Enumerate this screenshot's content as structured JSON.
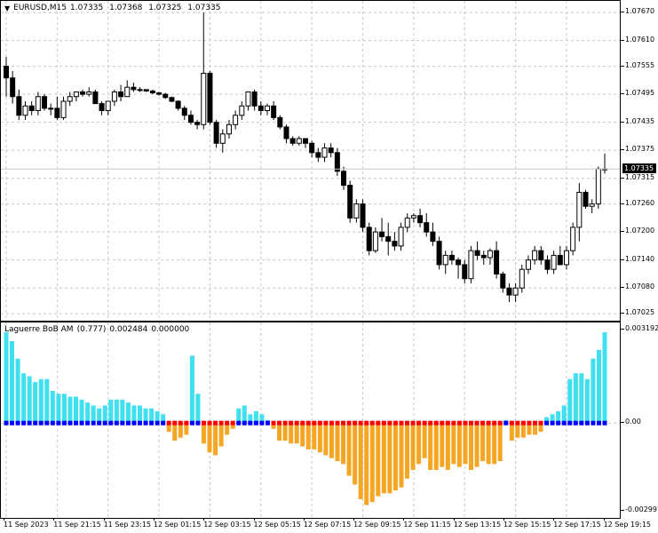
{
  "symbol_header": {
    "arrow": "▼",
    "symbol": "EURUSD,M15",
    "open": "1.07335",
    "high": "1.07368",
    "low": "1.07325",
    "close": "1.07335"
  },
  "indicator_header": {
    "name": "Laguerre BoB AM",
    "param": "(0.777)",
    "value1": "0.002484",
    "value2": "0.000000"
  },
  "price_axis": {
    "labels": [
      "1.07670",
      "1.07610",
      "1.07555",
      "1.07495",
      "1.07435",
      "1.07375",
      "1.07315",
      "1.07260",
      "1.07200",
      "1.07140",
      "1.07080",
      "1.07025"
    ],
    "values": [
      1.0767,
      1.0761,
      1.07555,
      1.07495,
      1.07435,
      1.07375,
      1.07315,
      1.0726,
      1.072,
      1.0714,
      1.0708,
      1.07025
    ],
    "min": 1.0701,
    "max": 1.07695,
    "current_price": "1.07335",
    "current_value": 1.07335
  },
  "indicator_axis": {
    "labels": [
      "0.003192",
      "0.00",
      "-0.002997"
    ],
    "values": [
      0.003192,
      0.0,
      -0.002997
    ]
  },
  "time_axis": {
    "labels": [
      "11 Sep 2023",
      "11 Sep 21:15",
      "11 Sep 23:15",
      "12 Sep 01:15",
      "12 Sep 03:15",
      "12 Sep 05:15",
      "12 Sep 07:15",
      "12 Sep 09:15",
      "12 Sep 11:15",
      "12 Sep 13:15",
      "12 Sep 15:15",
      "12 Sep 17:15",
      "12 Sep 19:15"
    ]
  },
  "chart_data": [
    {
      "type": "candlestick",
      "title": "EURUSD,M15",
      "ylim": [
        1.0701,
        1.07695
      ],
      "grid": true,
      "candles": [
        [
          1.07555,
          1.07575,
          1.0749,
          1.0753
        ],
        [
          1.0753,
          1.07545,
          1.07475,
          1.0749
        ],
        [
          1.0749,
          1.07505,
          1.0744,
          1.0745
        ],
        [
          1.0745,
          1.0748,
          1.0744,
          1.0747
        ],
        [
          1.0747,
          1.0748,
          1.0745,
          1.0746
        ],
        [
          1.0746,
          1.075,
          1.0745,
          1.0749
        ],
        [
          1.0749,
          1.07495,
          1.0746,
          1.07465
        ],
        [
          1.07465,
          1.07475,
          1.0745,
          1.07465
        ],
        [
          1.07465,
          1.0749,
          1.0744,
          1.07445
        ],
        [
          1.07445,
          1.0749,
          1.0744,
          1.0748
        ],
        [
          1.0748,
          1.075,
          1.0747,
          1.0749
        ],
        [
          1.0749,
          1.075,
          1.0748,
          1.075
        ],
        [
          1.075,
          1.07505,
          1.0749,
          1.07495
        ],
        [
          1.07495,
          1.0751,
          1.0749,
          1.075
        ],
        [
          1.075,
          1.07505,
          1.0748,
          1.07475
        ],
        [
          1.07475,
          1.0748,
          1.0745,
          1.0746
        ],
        [
          1.0746,
          1.0748,
          1.0745,
          1.0748
        ],
        [
          1.0748,
          1.07505,
          1.0747,
          1.075
        ],
        [
          1.075,
          1.07515,
          1.0748,
          1.0749
        ],
        [
          1.0749,
          1.07525,
          1.0749,
          1.0751
        ],
        [
          1.0751,
          1.0752,
          1.075,
          1.07505
        ],
        [
          1.07505,
          1.0751,
          1.075,
          1.07505
        ],
        [
          1.07505,
          1.07505,
          1.075,
          1.07502
        ],
        [
          1.07502,
          1.07505,
          1.07495,
          1.07498
        ],
        [
          1.07498,
          1.075,
          1.07492,
          1.07495
        ],
        [
          1.07495,
          1.07498,
          1.07485,
          1.07488
        ],
        [
          1.07488,
          1.0749,
          1.07478,
          1.0748
        ],
        [
          1.0748,
          1.07482,
          1.0746,
          1.07465
        ],
        [
          1.07465,
          1.0747,
          1.0744,
          1.0745
        ],
        [
          1.0745,
          1.0746,
          1.0743,
          1.07435
        ],
        [
          1.07435,
          1.0744,
          1.0742,
          1.0743
        ],
        [
          1.0743,
          1.0767,
          1.0742,
          1.0754
        ],
        [
          1.0754,
          1.07545,
          1.0743,
          1.07435
        ],
        [
          1.07435,
          1.0744,
          1.0738,
          1.0739
        ],
        [
          1.0739,
          1.0742,
          1.0737,
          1.0741
        ],
        [
          1.0741,
          1.0744,
          1.074,
          1.0743
        ],
        [
          1.0743,
          1.0746,
          1.0742,
          1.0745
        ],
        [
          1.0745,
          1.0748,
          1.0744,
          1.0747
        ],
        [
          1.0747,
          1.075,
          1.0746,
          1.075
        ],
        [
          1.075,
          1.07505,
          1.0746,
          1.0747
        ],
        [
          1.0747,
          1.0748,
          1.0745,
          1.0746
        ],
        [
          1.0746,
          1.07475,
          1.0745,
          1.0747
        ],
        [
          1.0747,
          1.0748,
          1.0744,
          1.07445
        ],
        [
          1.07445,
          1.0745,
          1.0742,
          1.07425
        ],
        [
          1.07425,
          1.0743,
          1.0739,
          1.074
        ],
        [
          1.074,
          1.07405,
          1.07385,
          1.0739
        ],
        [
          1.0739,
          1.07405,
          1.07385,
          1.074
        ],
        [
          1.074,
          1.074,
          1.0738,
          1.0739
        ],
        [
          1.0739,
          1.07395,
          1.0736,
          1.0737
        ],
        [
          1.0737,
          1.0738,
          1.0735,
          1.0736
        ],
        [
          1.0736,
          1.0739,
          1.0735,
          1.0738
        ],
        [
          1.0738,
          1.0739,
          1.0736,
          1.0737
        ],
        [
          1.0737,
          1.0738,
          1.0732,
          1.0733
        ],
        [
          1.0733,
          1.0734,
          1.0729,
          1.073
        ],
        [
          1.073,
          1.0731,
          1.0722,
          1.0723
        ],
        [
          1.0723,
          1.0727,
          1.0722,
          1.0726
        ],
        [
          1.0726,
          1.0727,
          1.072,
          1.0721
        ],
        [
          1.0721,
          1.0722,
          1.0715,
          1.0716
        ],
        [
          1.0716,
          1.0721,
          1.07155,
          1.072
        ],
        [
          1.072,
          1.0723,
          1.0718,
          1.0719
        ],
        [
          1.0719,
          1.0722,
          1.0715,
          1.0718
        ],
        [
          1.0718,
          1.072,
          1.0716,
          1.0717
        ],
        [
          1.0717,
          1.0722,
          1.0716,
          1.0721
        ],
        [
          1.0721,
          1.0724,
          1.072,
          1.0723
        ],
        [
          1.0723,
          1.0724,
          1.0722,
          1.07235
        ],
        [
          1.07235,
          1.0725,
          1.0721,
          1.0722
        ],
        [
          1.0722,
          1.0724,
          1.0719,
          1.072
        ],
        [
          1.072,
          1.0722,
          1.0717,
          1.0718
        ],
        [
          1.0718,
          1.0719,
          1.0712,
          1.0713
        ],
        [
          1.0713,
          1.0716,
          1.0711,
          1.0715
        ],
        [
          1.0715,
          1.0716,
          1.0713,
          1.0714
        ],
        [
          1.0714,
          1.07145,
          1.071,
          1.0713
        ],
        [
          1.0713,
          1.0714,
          1.0709,
          1.071
        ],
        [
          1.071,
          1.0717,
          1.0709,
          1.0716
        ],
        [
          1.0716,
          1.0718,
          1.0714,
          1.0715
        ],
        [
          1.0715,
          1.0716,
          1.0713,
          1.07145
        ],
        [
          1.07145,
          1.07165,
          1.0713,
          1.0716
        ],
        [
          1.0716,
          1.0718,
          1.071,
          1.0711
        ],
        [
          1.0711,
          1.07115,
          1.0707,
          1.0708
        ],
        [
          1.0708,
          1.0709,
          1.0705,
          1.07065
        ],
        [
          1.07065,
          1.0709,
          1.0705,
          1.0708
        ],
        [
          1.0708,
          1.0713,
          1.0707,
          1.0712
        ],
        [
          1.0712,
          1.0715,
          1.0711,
          1.0714
        ],
        [
          1.0714,
          1.0717,
          1.0713,
          1.0716
        ],
        [
          1.0716,
          1.0717,
          1.0713,
          1.0714
        ],
        [
          1.0714,
          1.0715,
          1.0711,
          1.0712
        ],
        [
          1.0712,
          1.0716,
          1.0711,
          1.0715
        ],
        [
          1.0715,
          1.0717,
          1.0713,
          1.0713
        ],
        [
          1.0713,
          1.0717,
          1.0712,
          1.0716
        ],
        [
          1.0716,
          1.0722,
          1.0715,
          1.0721
        ],
        [
          1.0721,
          1.07305,
          1.0718,
          1.07285
        ],
        [
          1.07285,
          1.0729,
          1.0725,
          1.07255
        ],
        [
          1.07255,
          1.0727,
          1.0724,
          1.0726
        ],
        [
          1.0726,
          1.0734,
          1.0725,
          1.07335
        ],
        [
          1.07335,
          1.07368,
          1.07325,
          1.07335
        ]
      ]
    },
    {
      "type": "bar",
      "title": "Laguerre BoB AM (0.777)",
      "ylim": [
        -0.002997,
        0.003192
      ],
      "zero_colors": {
        "positive": "#0000ff",
        "negative": "#ff0000"
      },
      "bar_colors": {
        "positive": "#40e0f0",
        "negative": "#f5a623"
      },
      "values": [
        0.0031,
        0.0028,
        0.0022,
        0.0017,
        0.0016,
        0.0014,
        0.0015,
        0.0015,
        0.0011,
        0.001,
        0.001,
        0.0009,
        0.0009,
        0.0008,
        0.0007,
        0.0006,
        0.0005,
        0.0006,
        0.0008,
        0.0008,
        0.0008,
        0.0007,
        0.0006,
        0.0006,
        0.0005,
        0.0005,
        0.0004,
        0.0003,
        -0.0003,
        -0.0006,
        -0.0005,
        -0.0004,
        0.0023,
        0.001,
        -0.0007,
        -0.001,
        -0.0011,
        -0.0008,
        -0.0004,
        -0.0002,
        0.0005,
        0.0006,
        0.0003,
        0.0004,
        0.0003,
        0.0001,
        -0.0002,
        -0.0006,
        -0.0006,
        -0.0007,
        -0.0007,
        -0.0008,
        -0.0009,
        -0.0009,
        -0.001,
        -0.0011,
        -0.0012,
        -0.0013,
        -0.0014,
        -0.0018,
        -0.0021,
        -0.0026,
        -0.0028,
        -0.0027,
        -0.0025,
        -0.0024,
        -0.0024,
        -0.0023,
        -0.0022,
        -0.0019,
        -0.0016,
        -0.0014,
        -0.0012,
        -0.0016,
        -0.0016,
        -0.0015,
        -0.0016,
        -0.0014,
        -0.0015,
        -0.0014,
        -0.0016,
        -0.0015,
        -0.0013,
        -0.0014,
        -0.0014,
        -0.0013,
        0.0001,
        -0.0006,
        -0.0005,
        -0.0005,
        -0.0004,
        -0.0004,
        -0.0003,
        0.0002,
        0.0003,
        0.0004,
        0.0006,
        0.0015,
        0.0017,
        0.0017,
        0.0015,
        0.0022,
        0.0025,
        0.0031
      ]
    }
  ]
}
